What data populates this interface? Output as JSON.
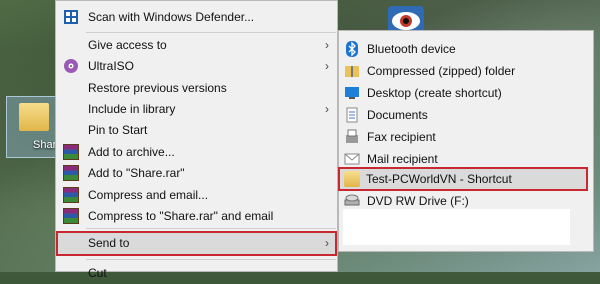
{
  "desktop": {
    "icon_label": "Share"
  },
  "context_menu": {
    "items": [
      {
        "label": "Scan with Windows Defender...",
        "icon": "windows-defender-icon",
        "has_submenu": false
      },
      {
        "label": "Give access to",
        "icon": "",
        "has_submenu": true
      },
      {
        "label": "UltraISO",
        "icon": "ultraiso-icon",
        "has_submenu": true
      },
      {
        "label": "Restore previous versions",
        "icon": "",
        "has_submenu": false
      },
      {
        "label": "Include in library",
        "icon": "",
        "has_submenu": true
      },
      {
        "label": "Pin to Start",
        "icon": "",
        "has_submenu": false
      },
      {
        "label": "Add to archive...",
        "icon": "winrar-icon",
        "has_submenu": false
      },
      {
        "label": "Add to \"Share.rar\"",
        "icon": "winrar-icon",
        "has_submenu": false
      },
      {
        "label": "Compress and email...",
        "icon": "winrar-icon",
        "has_submenu": false
      },
      {
        "label": "Compress to \"Share.rar\" and email",
        "icon": "winrar-icon",
        "has_submenu": false
      },
      {
        "label": "Send to",
        "icon": "",
        "has_submenu": true,
        "selected": true
      },
      {
        "label": "Cut",
        "icon": "",
        "has_submenu": false
      }
    ],
    "arrow_glyph": "›"
  },
  "send_to_menu": {
    "items": [
      {
        "label": "Bluetooth device",
        "icon": "bluetooth-icon"
      },
      {
        "label": "Compressed (zipped) folder",
        "icon": "zip-folder-icon"
      },
      {
        "label": "Desktop (create shortcut)",
        "icon": "desktop-icon"
      },
      {
        "label": "Documents",
        "icon": "documents-icon"
      },
      {
        "label": "Fax recipient",
        "icon": "fax-icon"
      },
      {
        "label": "Mail recipient",
        "icon": "mail-icon"
      },
      {
        "label": "Test-PCWorldVN - Shortcut",
        "icon": "folder-icon",
        "selected": true
      },
      {
        "label": "DVD RW Drive (F:)",
        "icon": "dvd-drive-icon"
      }
    ]
  },
  "colors": {
    "menu_bg": "#f0f0f0",
    "highlight_border": "#c8282f",
    "selected_bg": "#dadada"
  }
}
